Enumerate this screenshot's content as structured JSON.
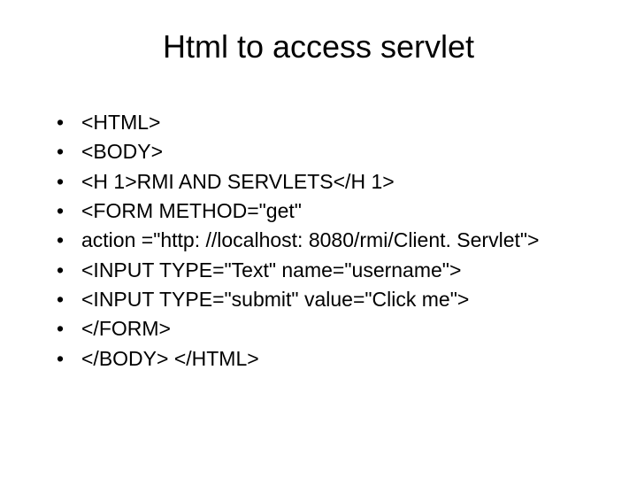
{
  "title": "Html to access servlet",
  "bullets": [
    "<HTML>",
    "<BODY>",
    "<H 1>RMI AND SERVLETS</H 1>",
    "<FORM METHOD=\"get\"",
    "action =\"http: //localhost: 8080/rmi/Client. Servlet\">",
    "<INPUT TYPE=\"Text\" name=\"username\">",
    "<INPUT TYPE=\"submit\" value=\"Click me\">",
    "</FORM>",
    "</BODY> </HTML>"
  ]
}
